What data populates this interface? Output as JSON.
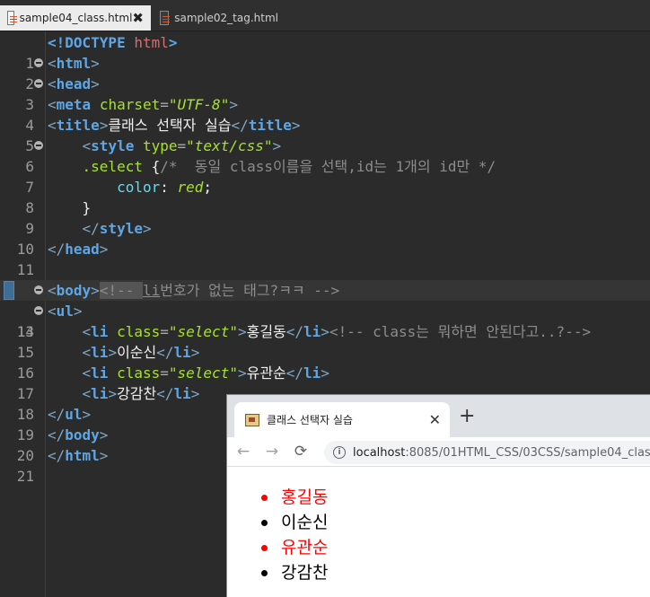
{
  "editor": {
    "tabs": [
      {
        "label": "sample04_class.html",
        "active": true
      },
      {
        "label": "sample02_tag.html",
        "active": false
      }
    ],
    "close_glyph": "✖",
    "line_numbers": [
      "1",
      "2",
      "3",
      "4",
      "5",
      "6",
      "7",
      "8",
      "9",
      "10",
      "11",
      "12",
      "13",
      "14",
      "15",
      "16",
      "17",
      "18",
      "19",
      "20",
      "21"
    ],
    "code": {
      "l1_doctype": "<!DOCTYPE",
      "l1_html": "html",
      "l1_close": ">",
      "l2": "html",
      "l3": "head",
      "l4_tag": "meta",
      "l4_attr": "charset",
      "l4_val": "\"UTF-8\"",
      "l5_tag": "title",
      "l5_text": "클래스 선택자 실습",
      "l6_tag": "style",
      "l6_attr": "type",
      "l6_val": "\"text/css\"",
      "l7_selector": ".select",
      "l7_brace": " {",
      "l7_comment": "/*  동일 class이름을 선택,id는 1개의 id만 */",
      "l8_prop": "color",
      "l8_colon": ": ",
      "l8_val": "red",
      "l8_semi": ";",
      "l9": "}",
      "l10_tag": "style",
      "l11_tag": "head",
      "l13_tag": "body",
      "l13_comment_a": "<!-- ",
      "l13_comment_li": "li",
      "l13_comment_b": "번호가 없는 태그?ㅋㅋ -->",
      "l14_tag": "ul",
      "li_tag": "li",
      "class_attr": "class",
      "class_val": "\"select\"",
      "l15_text": "홍길동",
      "l15_comment": "<!-- class는 뭐하면 안된다고..?-->",
      "l16_text": "이순신",
      "l17_text": "유관순",
      "l18_text": "강감찬",
      "l19_tag": "ul",
      "l20_tag": "body",
      "l21_tag": "html"
    }
  },
  "browser": {
    "tab_title": "클래스 선택자 실습",
    "tab_close": "✕",
    "new_tab": "+",
    "back": "←",
    "forward": "→",
    "reload": "⟳",
    "info": "i",
    "url_host": "localhost",
    "url_path": ":8085/01HTML_CSS/03CSS/sample04_class.html",
    "items": [
      {
        "text": "홍길동",
        "color": "#ff0000"
      },
      {
        "text": "이순신",
        "color": "#000000"
      },
      {
        "text": "유관순",
        "color": "#ff0000"
      },
      {
        "text": "강감찬",
        "color": "#000000"
      }
    ]
  },
  "colors": {
    "tag": "#5ea6e6",
    "attribute": "#a6e22e",
    "comment": "#8c8c8c",
    "highlight_red": "#ff0000"
  }
}
